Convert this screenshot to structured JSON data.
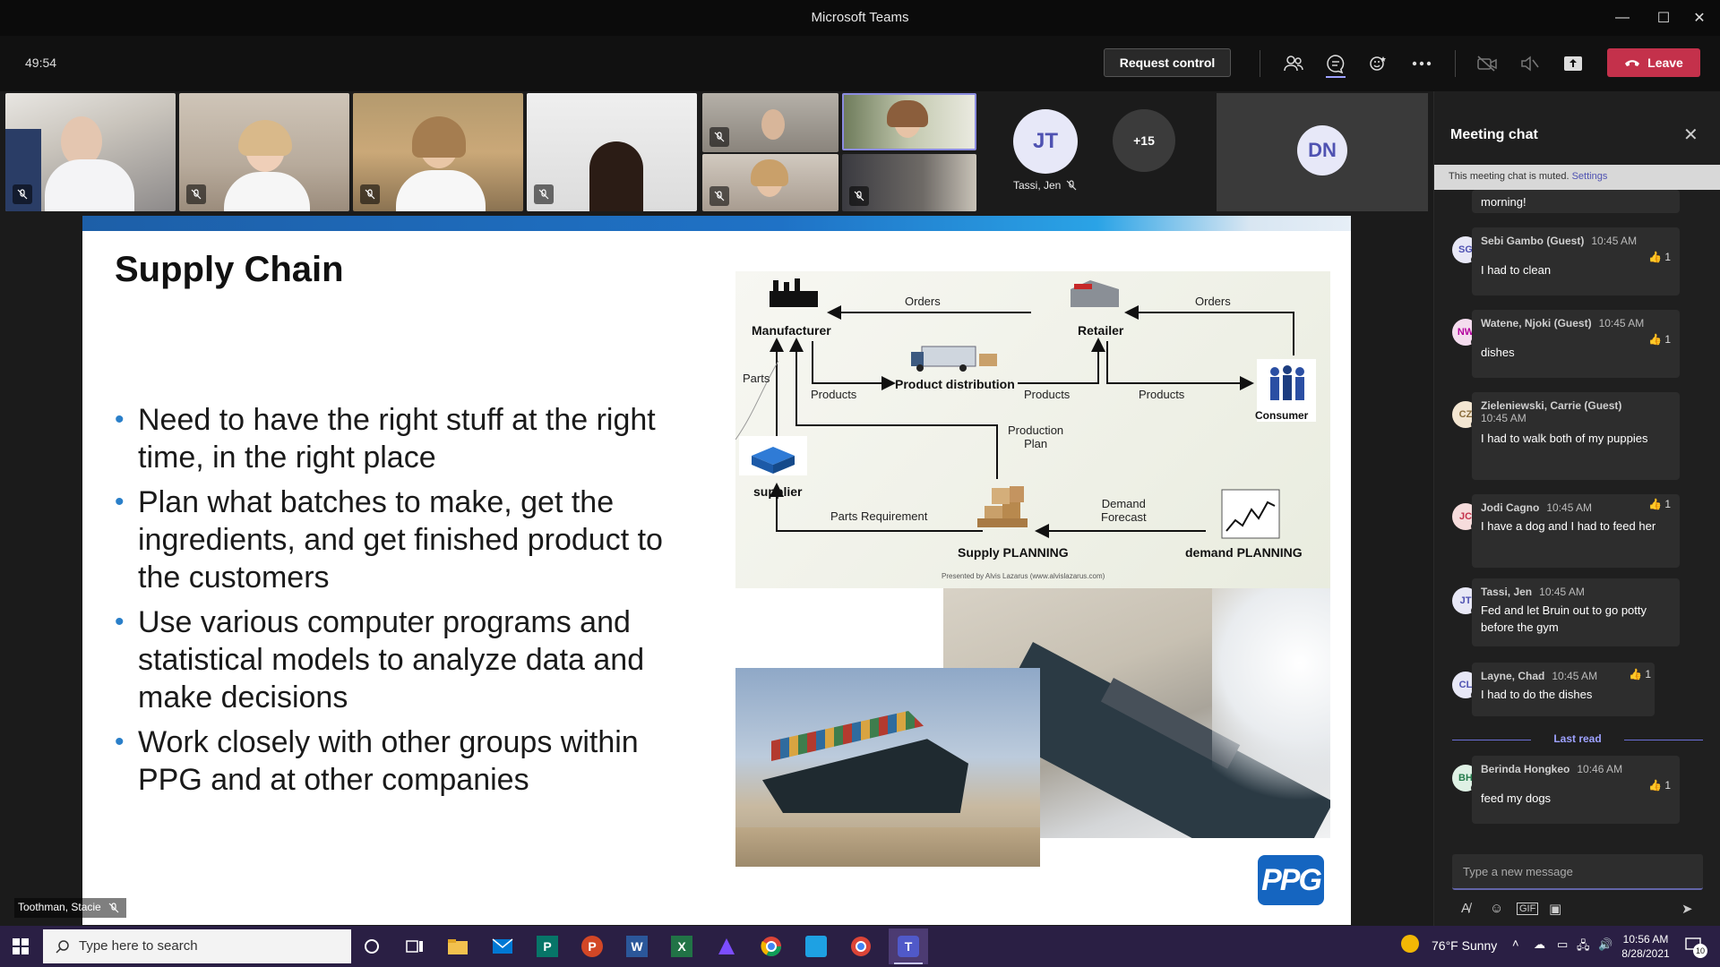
{
  "window": {
    "title": "Microsoft Teams"
  },
  "toolbar": {
    "timer": "49:54",
    "request_control": "Request control",
    "leave": "Leave"
  },
  "participants": {
    "jt_initials": "JT",
    "jt_name": "Tassi, Jen",
    "more_count": "+15",
    "dn_initials": "DN"
  },
  "slide": {
    "title": "Supply Chain",
    "bullets": [
      "Need to have the right stuff at the right time, in the right place",
      "Plan what batches to make, get the ingredients, and get finished product to the customers",
      "Use various computer programs and statistical models to analyze data and make decisions",
      "Work closely with other groups within PPG and at other companies"
    ],
    "diagram": {
      "manufacturer": "Manufacturer",
      "retailer": "Retailer",
      "consumer": "Consumer",
      "supplier": "supplier",
      "product_distribution": "Product distribution",
      "supply_planning": "Supply PLANNING",
      "demand_planning": "demand PLANNING",
      "orders": "Orders",
      "products": "Products",
      "parts": "Parts",
      "production_plan_1": "Production",
      "production_plan_2": "Plan",
      "demand_forecast_1": "Demand",
      "demand_forecast_2": "Forecast",
      "parts_requirement": "Parts Requirement",
      "credit": "Presented by Alvis Lazarus (www.alvislazarus.com)"
    },
    "logo": "PPG"
  },
  "speaker": {
    "name": "Toothman, Stacie"
  },
  "chat": {
    "header": "Meeting chat",
    "muted_text": "This meeting chat is muted.",
    "muted_link": "Settings",
    "partial_msg": "morning!",
    "messages": [
      {
        "initials": "SG",
        "name": "Sebi Gambo (Guest)",
        "time": "10:45 AM",
        "text": "I had to clean",
        "reaction": "1"
      },
      {
        "initials": "NW",
        "name": "Watene, Njoki (Guest)",
        "time": "10:45 AM",
        "text": "dishes",
        "reaction": "1"
      },
      {
        "initials": "CZ",
        "name": "Zieleniewski, Carrie (Guest)",
        "time": "10:45 AM",
        "text": "I had to walk both of my puppies",
        "reaction": ""
      },
      {
        "initials": "JC",
        "name": "Jodi Cagno",
        "time": "10:45 AM",
        "text": "I have a dog and I had to feed her",
        "reaction": "1"
      },
      {
        "initials": "JT",
        "name": "Tassi, Jen",
        "time": "10:45 AM",
        "text": "Fed and let Bruin out to go potty before the gym",
        "reaction": ""
      },
      {
        "initials": "CL",
        "name": "Layne, Chad",
        "time": "10:45 AM",
        "text": "I had to do the dishes",
        "reaction": "1"
      },
      {
        "initials": "BH",
        "name": "Berinda Hongkeo",
        "time": "10:46 AM",
        "text": "feed my dogs",
        "reaction": "1"
      }
    ],
    "last_read": "Last read",
    "compose_placeholder": "Type a new message"
  },
  "taskbar": {
    "search_placeholder": "Type here to search",
    "weather": "76°F  Sunny",
    "time": "10:56 AM",
    "date": "8/28/2021",
    "notif_count": "10"
  }
}
